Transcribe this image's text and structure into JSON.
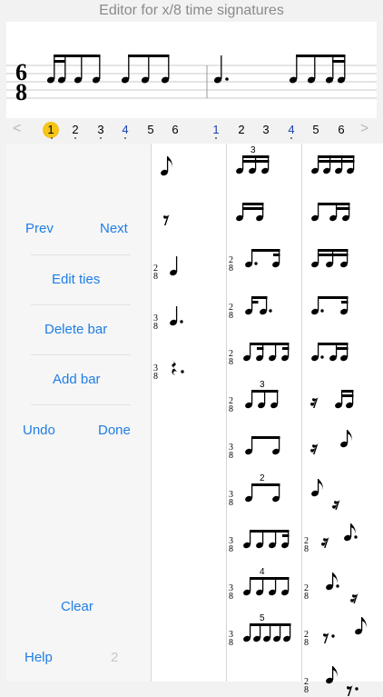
{
  "header": {
    "title": "Editor for x/8 time signatures"
  },
  "staff": {
    "time_signature_top": "6",
    "time_signature_bottom": "8"
  },
  "beat_nav": {
    "prev_arrow": "<",
    "next_arrow": ">",
    "bar1": [
      "1",
      "2",
      "3",
      "4",
      "5",
      "6"
    ],
    "bar2": [
      "1",
      "2",
      "3",
      "4",
      "5",
      "6"
    ],
    "selected_beat": "1"
  },
  "panel": {
    "prev": "Prev",
    "next": "Next",
    "edit_ties": "Edit ties",
    "delete_bar": "Delete bar",
    "add_bar": "Add bar",
    "undo": "Undo",
    "done": "Done",
    "clear": "Clear",
    "help": "Help",
    "page_number": "2"
  },
  "palette": {
    "col1": [
      {
        "label": "eighth note",
        "ts": ""
      },
      {
        "label": "eighth rest",
        "ts": ""
      },
      {
        "label": "quarter note",
        "ts": [
          "2",
          "8"
        ]
      },
      {
        "label": "dotted quarter note",
        "ts": [
          "3",
          "8"
        ]
      },
      {
        "label": "dotted quarter rest",
        "ts": [
          "3",
          "8"
        ]
      }
    ],
    "col2": [
      {
        "label": "sixteenth triplet",
        "ts": "",
        "tuplet": "3"
      },
      {
        "label": "two sixteenths",
        "ts": ""
      },
      {
        "label": "dotted eighth + sixteenth",
        "ts": [
          "2",
          "8"
        ]
      },
      {
        "label": "sixteenth + dotted eighth",
        "ts": [
          "2",
          "8"
        ]
      },
      {
        "label": "eighth + two sixteenths pattern",
        "ts": [
          "2",
          "8"
        ]
      },
      {
        "label": "eighth triplet",
        "ts": [
          "2",
          "8"
        ],
        "tuplet": "3"
      },
      {
        "label": "dotted quarter + eighth",
        "ts": [
          "3",
          "8"
        ]
      },
      {
        "label": "duplet",
        "ts": [
          "3",
          "8"
        ],
        "tuplet": "2"
      },
      {
        "label": "mixed eighths and sixteenths",
        "ts": [
          "3",
          "8"
        ]
      },
      {
        "label": "quadruplet",
        "ts": [
          "3",
          "8"
        ],
        "tuplet": "4"
      },
      {
        "label": "quintuplet",
        "ts": [
          "3",
          "8"
        ],
        "tuplet": "5"
      }
    ],
    "col3": [
      {
        "label": "four sixteenths",
        "ts": ""
      },
      {
        "label": "eighth + two sixteenths",
        "ts": ""
      },
      {
        "label": "three sixteenths dotted",
        "ts": ""
      },
      {
        "label": "dotted eighth sixteenth",
        "ts": ""
      },
      {
        "label": "dotted eighth two sixteenths",
        "ts": ""
      },
      {
        "label": "sixteenth rest + sixteenths",
        "ts": ""
      },
      {
        "label": "sixteenth rest + eighth",
        "ts": ""
      },
      {
        "label": "eighth + sixteenth rest",
        "ts": ""
      },
      {
        "label": "sixteenth rest + dotted eighth",
        "ts": [
          "2",
          "8"
        ]
      },
      {
        "label": "dotted eighth + sixteenth rest",
        "ts": [
          "2",
          "8"
        ]
      },
      {
        "label": "dotted eighth rest + sixteenth",
        "ts": [
          "2",
          "8"
        ]
      },
      {
        "label": "sixteenth + dotted eighth rest",
        "ts": [
          "2",
          "8"
        ]
      }
    ]
  }
}
